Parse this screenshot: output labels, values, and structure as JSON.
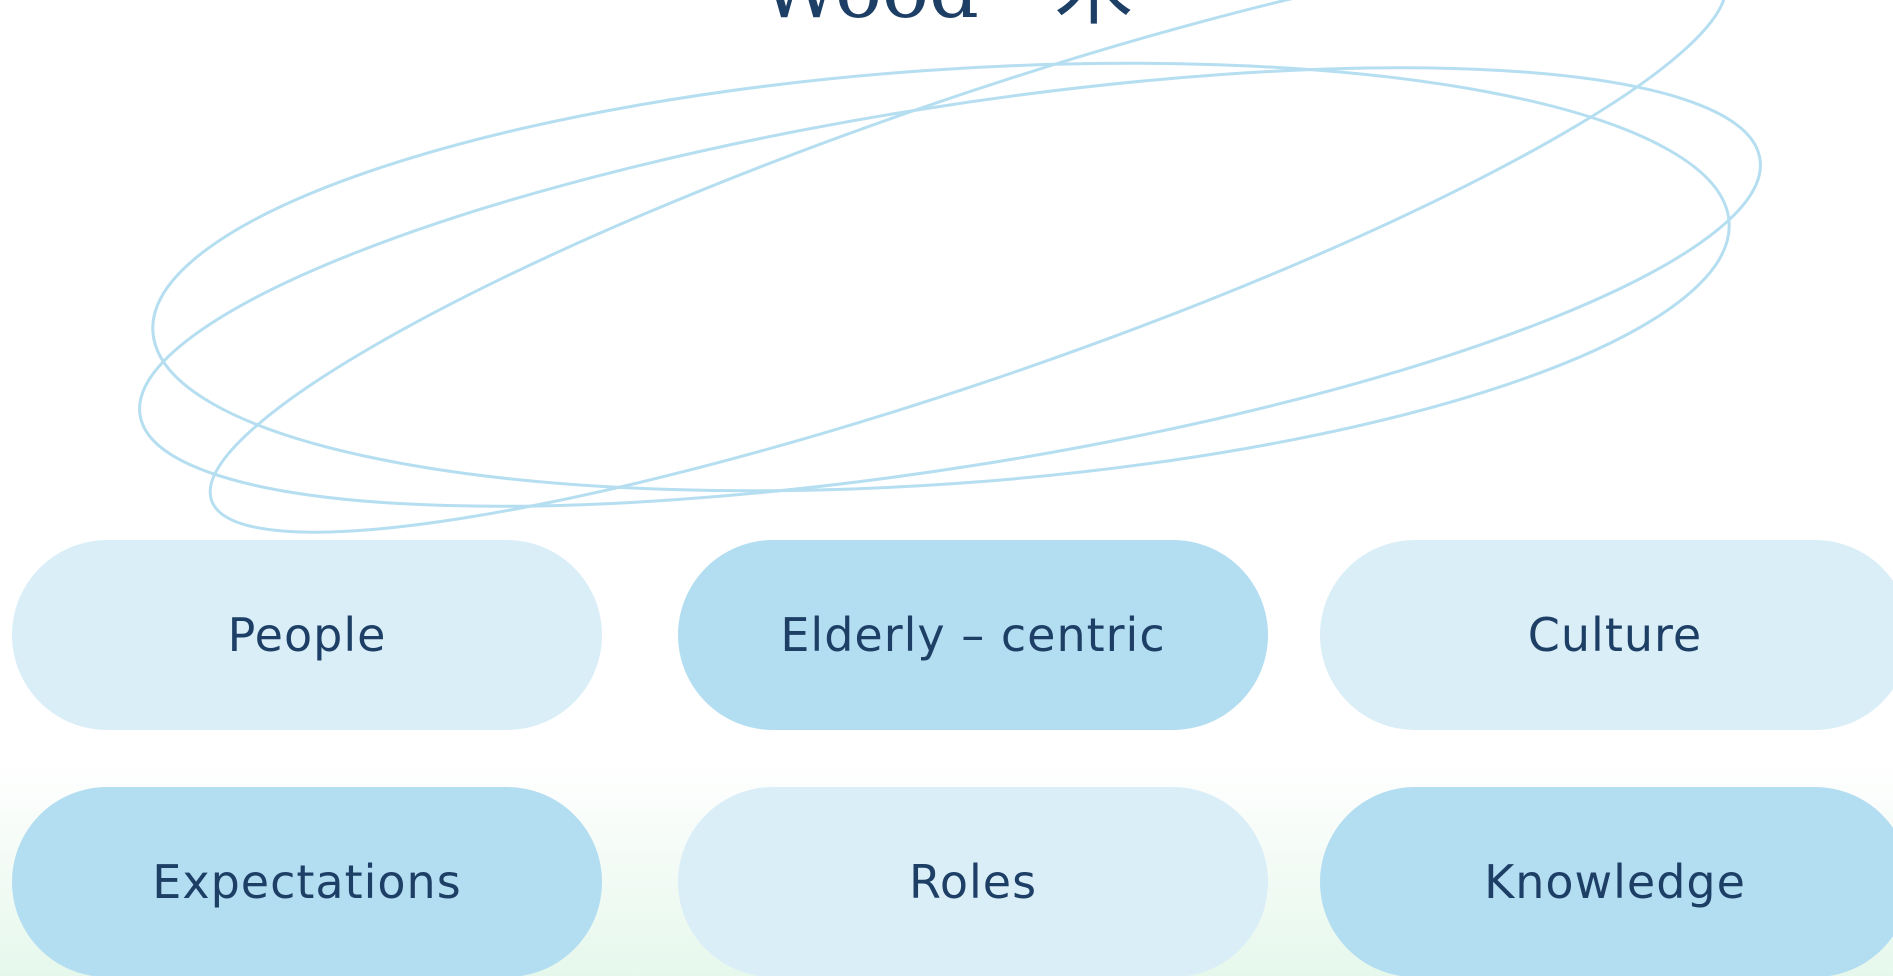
{
  "slide": {
    "title": "Wood - 木",
    "pills": [
      {
        "label": "People",
        "style": "light"
      },
      {
        "label": "Elderly – centric",
        "style": "mid"
      },
      {
        "label": "Culture",
        "style": "light"
      },
      {
        "label": "Expectations",
        "style": "mid"
      },
      {
        "label": "Roles",
        "style": "light"
      },
      {
        "label": "Knowledge",
        "style": "mid"
      }
    ]
  },
  "colors": {
    "title_text": "#1d3f66",
    "pill_light": "#daeef8",
    "pill_mid": "#b3ddf1",
    "orbit_line": "#a9d9ee"
  }
}
